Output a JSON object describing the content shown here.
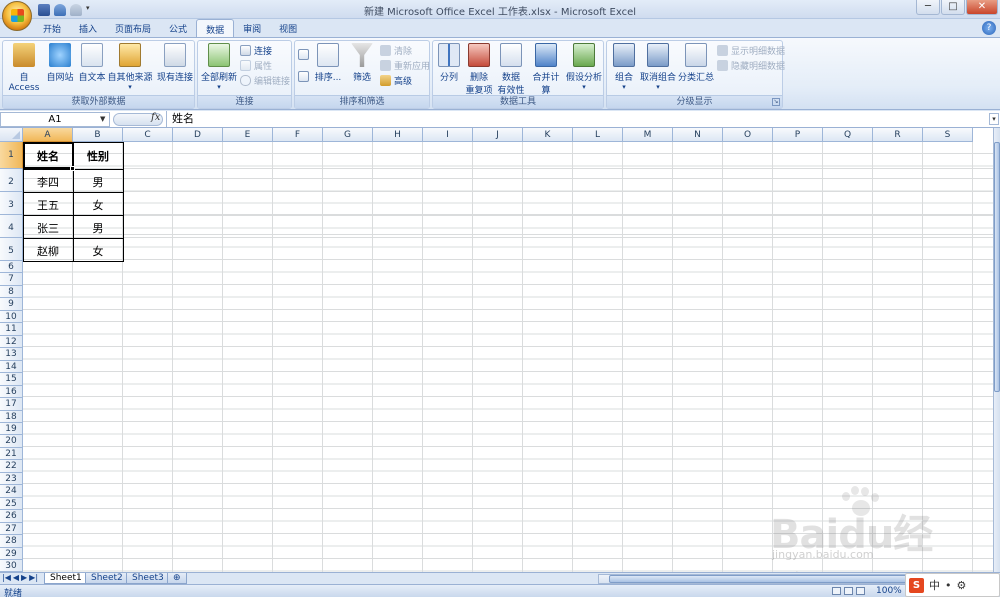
{
  "window": {
    "title": "新建 Microsoft Office Excel 工作表.xlsx - Microsoft Excel",
    "minimize": "─",
    "maximize": "□",
    "close": "✕"
  },
  "ribbon_tabs": [
    "开始",
    "插入",
    "页面布局",
    "公式",
    "数据",
    "审阅",
    "视图"
  ],
  "active_tab": "数据",
  "help_icon": "?",
  "groups": {
    "external": {
      "label": "获取外部数据",
      "buttons": [
        "自 Access",
        "自网站",
        "自文本",
        "自其他来源",
        "现有连接"
      ]
    },
    "connections": {
      "label": "连接",
      "refresh_all": "全部刷新",
      "small": [
        "连接",
        "属性",
        "编辑链接"
      ]
    },
    "sort_filter": {
      "label": "排序和筛选",
      "sort": "排序...",
      "filter": "筛选",
      "small": [
        "清除",
        "重新应用",
        "高级"
      ]
    },
    "data_tools": {
      "label": "数据工具",
      "buttons": [
        "分列",
        "删除重复项",
        "数据有效性",
        "合并计算",
        "假设分析"
      ],
      "remove_dup_lines": [
        "删除",
        "重复项"
      ],
      "validation_lines": [
        "数据",
        "有效性"
      ]
    },
    "outline": {
      "label": "分级显示",
      "buttons": [
        "组合",
        "取消组合",
        "分类汇总"
      ],
      "small": [
        "显示明细数据",
        "隐藏明细数据"
      ]
    }
  },
  "formula_bar": {
    "name_box": "A1",
    "fx": "fx",
    "content": "姓名"
  },
  "columns": [
    "A",
    "B",
    "C",
    "D",
    "E",
    "F",
    "G",
    "H",
    "I",
    "J",
    "K",
    "L",
    "M",
    "N",
    "O",
    "P",
    "Q",
    "R",
    "S"
  ],
  "rows": [
    "1",
    "2",
    "3",
    "4",
    "5",
    "6",
    "7",
    "8",
    "9",
    "10",
    "11",
    "12",
    "13",
    "14",
    "15",
    "16",
    "17",
    "18",
    "19",
    "20",
    "21",
    "22",
    "23",
    "24",
    "25",
    "26",
    "27",
    "28",
    "29",
    "30"
  ],
  "table": {
    "header": [
      "姓名",
      "性别"
    ],
    "rows": [
      [
        "李四",
        "男"
      ],
      [
        "王五",
        "女"
      ],
      [
        "张三",
        "男"
      ],
      [
        "赵柳",
        "女"
      ]
    ]
  },
  "sheets": [
    "Sheet1",
    "Sheet2",
    "Sheet3"
  ],
  "active_sheet": "Sheet1",
  "status": {
    "ready": "就绪",
    "zoom": "100%"
  },
  "ime": {
    "icon": "S",
    "mode": "中"
  },
  "watermark": {
    "text": "Baidu经验",
    "sub": "jingyan.baidu.com"
  }
}
